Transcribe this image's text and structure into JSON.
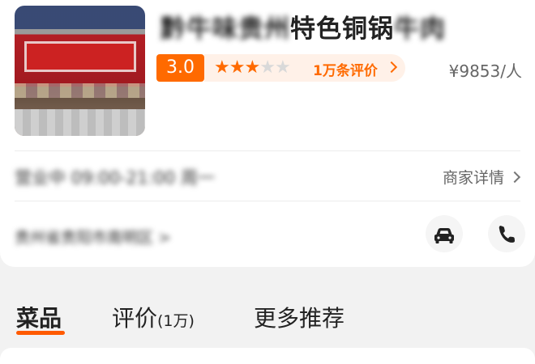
{
  "shop": {
    "name_blurred": "黔牛味贵州",
    "name_visible": "特色铜锅",
    "name_tail_blurred": "牛肉",
    "score": "3.0",
    "stars_filled": 3,
    "stars_total": 5,
    "review_count": "1万条评价",
    "price": "¥9853/人",
    "hours_blurred": "营业中 09:00-21:00 周一",
    "merchant_details": "商家详情",
    "address_blurred": "贵州省贵阳市南明区 >"
  },
  "tabs": [
    {
      "label": "菜品",
      "extra": ""
    },
    {
      "label": "评价",
      "extra": "(1万)"
    },
    {
      "label": "更多推荐",
      "extra": ""
    }
  ],
  "icons": {
    "car": "car-icon",
    "phone": "phone-icon"
  },
  "colors": {
    "accent": "#ff6a00",
    "accent_light": "#fff1e8",
    "tab_underline": "#ff5a00"
  }
}
